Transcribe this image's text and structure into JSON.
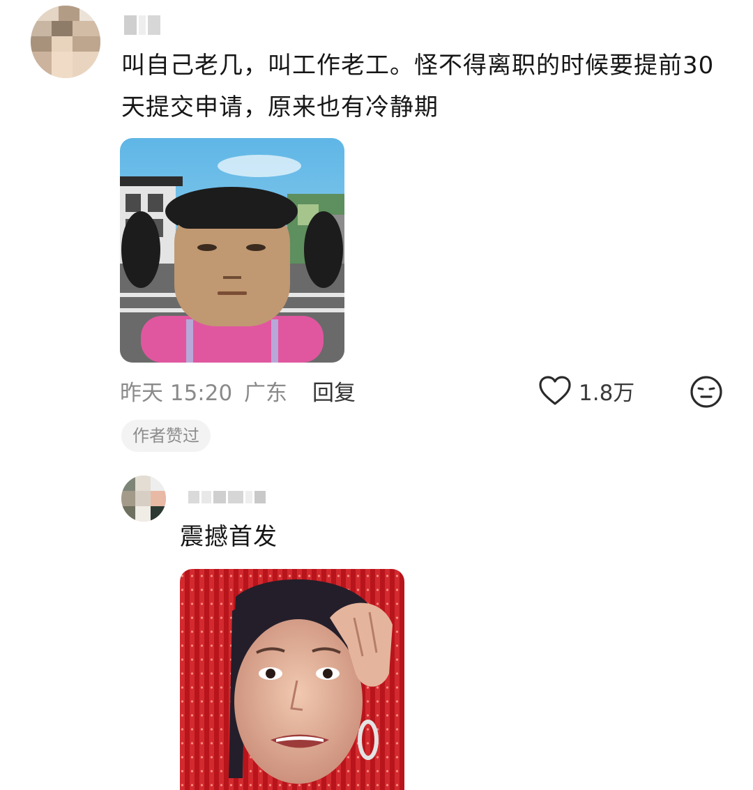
{
  "comment": {
    "text": "叫自己老几，叫工作老工。怪不得离职的时候要提前30天提交申请，原来也有冷静期",
    "time": "昨天 15:20",
    "location": "广东",
    "reply_label": "回复",
    "like_count": "1.8万",
    "badge": "作者赞过"
  },
  "reply": {
    "text": "震撼首发"
  },
  "icons": {
    "like": "heart-outline-icon",
    "emoji": "neutral-face-icon"
  }
}
